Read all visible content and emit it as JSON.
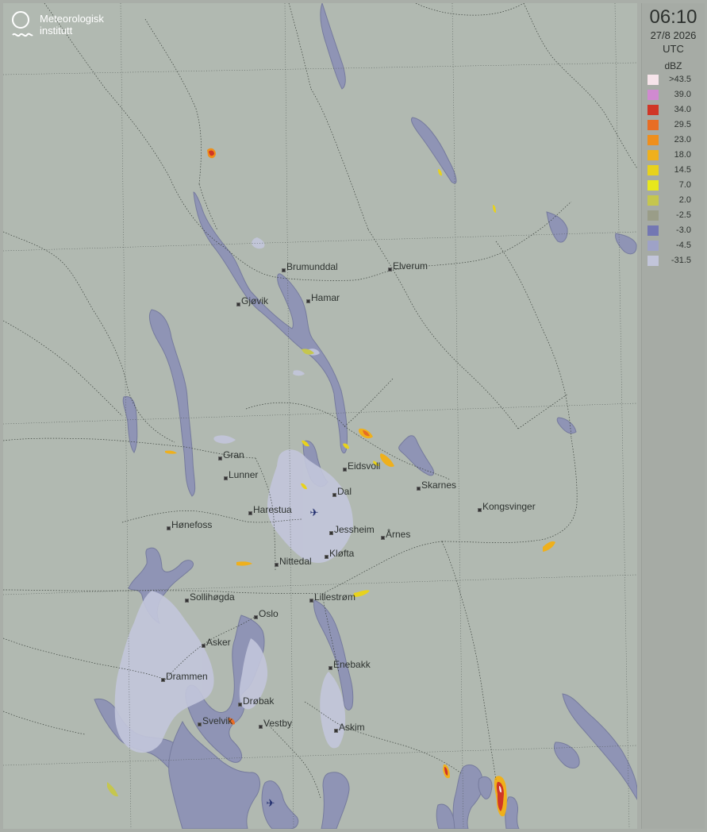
{
  "logo": {
    "line1": "Meteorologisk",
    "line2": "institutt"
  },
  "header": {
    "time": "06:10",
    "date": "27/8 2026",
    "timezone": "UTC",
    "unit": "dBZ"
  },
  "legend": [
    {
      "label": ">43.5",
      "color": "#f6e4ea"
    },
    {
      "label": "39.0",
      "color": "#d08ad0"
    },
    {
      "label": "34.0",
      "color": "#d03626"
    },
    {
      "label": "29.5",
      "color": "#e86d24"
    },
    {
      "label": "23.0",
      "color": "#ef8f1c"
    },
    {
      "label": "18.0",
      "color": "#efb01c"
    },
    {
      "label": "14.5",
      "color": "#e8d21c"
    },
    {
      "label": "7.0",
      "color": "#e8e81c"
    },
    {
      "label": "2.0",
      "color": "#c5c64e"
    },
    {
      "label": "-2.5",
      "color": "#9a9d88"
    },
    {
      "label": "-3.0",
      "color": "#7377b3"
    },
    {
      "label": "-4.5",
      "color": "#9ea2c7"
    },
    {
      "label": "-31.5",
      "color": "#c2c5da"
    }
  ],
  "cities": [
    {
      "name": "Brumunddal"
    },
    {
      "name": "Elverum"
    },
    {
      "name": "Gjøvik"
    },
    {
      "name": "Hamar"
    },
    {
      "name": "Gran"
    },
    {
      "name": "Eidsvoll"
    },
    {
      "name": "Lunner"
    },
    {
      "name": "Skarnes"
    },
    {
      "name": "Dal"
    },
    {
      "name": "Kongsvinger"
    },
    {
      "name": "Harestua"
    },
    {
      "name": "Hønefoss"
    },
    {
      "name": "Jessheim"
    },
    {
      "name": "Årnes"
    },
    {
      "name": "Kløfta"
    },
    {
      "name": "Nittedal"
    },
    {
      "name": "Lillestrøm"
    },
    {
      "name": "Sollihøgda"
    },
    {
      "name": "Oslo"
    },
    {
      "name": "Asker"
    },
    {
      "name": "Enebakk"
    },
    {
      "name": "Drammen"
    },
    {
      "name": "Drøbak"
    },
    {
      "name": "Svelvik"
    },
    {
      "name": "Vestby"
    },
    {
      "name": "Askim"
    }
  ],
  "icons": {
    "airport": "airplane-icon",
    "logo": "met-logo-icon"
  }
}
